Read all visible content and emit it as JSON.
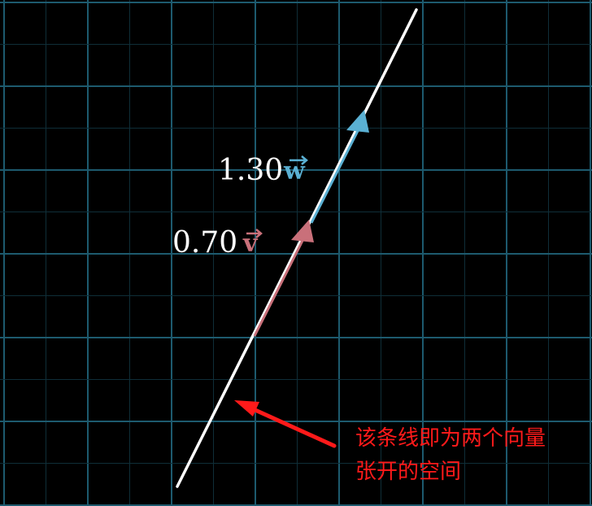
{
  "colors": {
    "background": "#000000",
    "grid_major": "#1d5a6e",
    "grid_minor": "#0f2e38",
    "span_line": "#ffffff",
    "vector_v": "#c9707a",
    "vector_w": "#5ab0d3",
    "annotation": "#ff1a1a",
    "label_text": "#ffffff"
  },
  "labels": {
    "w_coefficient": "1.30",
    "w_symbol": "w",
    "v_coefficient": "0.70",
    "v_symbol": "v"
  },
  "annotation": {
    "line1": "该条线即为两个向量",
    "line2": "张开的空间"
  },
  "icons": {
    "annotation_arrow": "red-arrow-icon"
  }
}
